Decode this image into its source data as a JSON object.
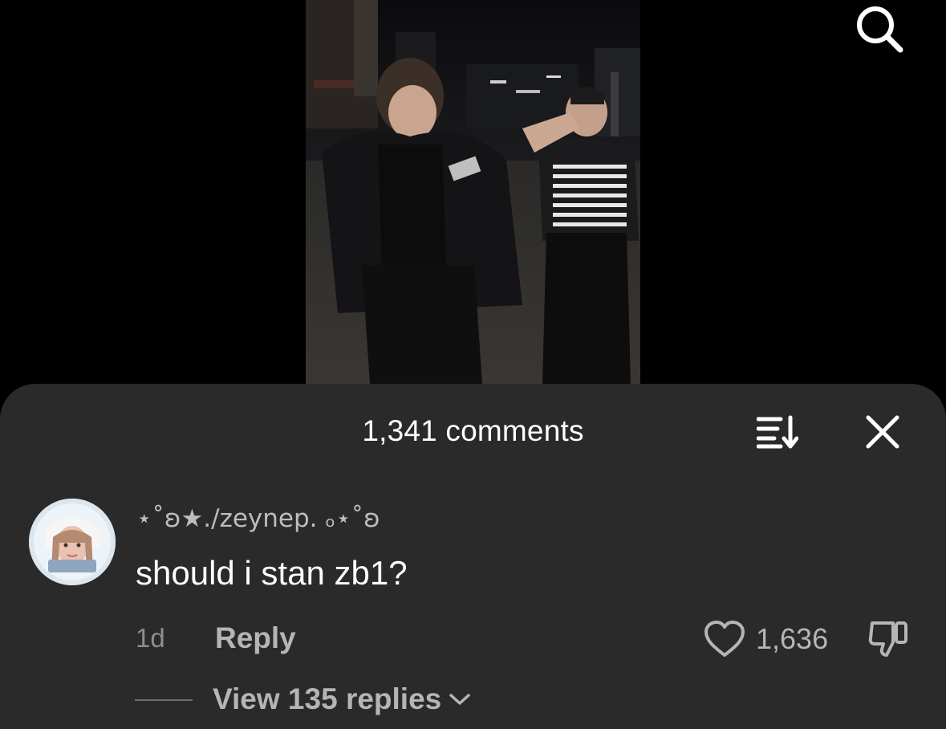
{
  "video": {
    "icon": "search-icon"
  },
  "comments_sheet": {
    "title": "1,341 comments",
    "sort_icon": "sort-icon",
    "close_icon": "close-icon"
  },
  "comment": {
    "username": "⋆˚ʚ★./zeynep. ₒ⋆˚ʚ",
    "text": "should i stan zb1?",
    "timestamp": "1d",
    "reply_label": "Reply",
    "like_count": "1,636",
    "like_icon": "heart-icon",
    "dislike_icon": "thumbs-down-icon",
    "view_replies_label": "View 135 replies",
    "chevron_icon": "chevron-down-icon"
  },
  "colors": {
    "sheet_bg": "#2a2a2a",
    "page_bg": "#000000",
    "primary_text": "#ffffff",
    "secondary_text": "#b5b5b5",
    "muted_text": "#8e8e8e"
  }
}
